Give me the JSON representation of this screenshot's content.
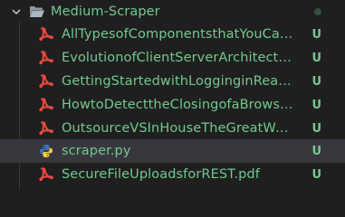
{
  "colors": {
    "background": "#1f1f1f",
    "selected_row": "#37373d",
    "git_untracked": "#73c991",
    "pdf_red": "#e8483f",
    "python_blue": "#3a77ba",
    "python_yellow": "#f6cf3b"
  },
  "folder": {
    "name": "Medium-Scraper",
    "expanded": true,
    "icon": "folder-open-icon",
    "chevron": "chevron-down-icon"
  },
  "files": [
    {
      "name": "AllTypesofComponentsthatYouCanUse...",
      "icon": "pdf-icon",
      "status": "U",
      "selected": false
    },
    {
      "name": "EvolutionofClientServerArchitecture.pdf",
      "icon": "pdf-icon",
      "status": "U",
      "selected": false
    },
    {
      "name": "GettingStartedwithLogginginReact.pdf",
      "icon": "pdf-icon",
      "status": "U",
      "selected": false
    },
    {
      "name": "HowtoDetecttheClosingofaBrowserTab...",
      "icon": "pdf-icon",
      "status": "U",
      "selected": false
    },
    {
      "name": "OutsourceVSInHouseTheGreatWebScr...",
      "icon": "pdf-icon",
      "status": "U",
      "selected": false
    },
    {
      "name": "scraper.py",
      "icon": "python-icon",
      "status": "U",
      "selected": true
    },
    {
      "name": "SecureFileUploadsforREST.pdf",
      "icon": "pdf-icon",
      "status": "U",
      "selected": false
    }
  ]
}
